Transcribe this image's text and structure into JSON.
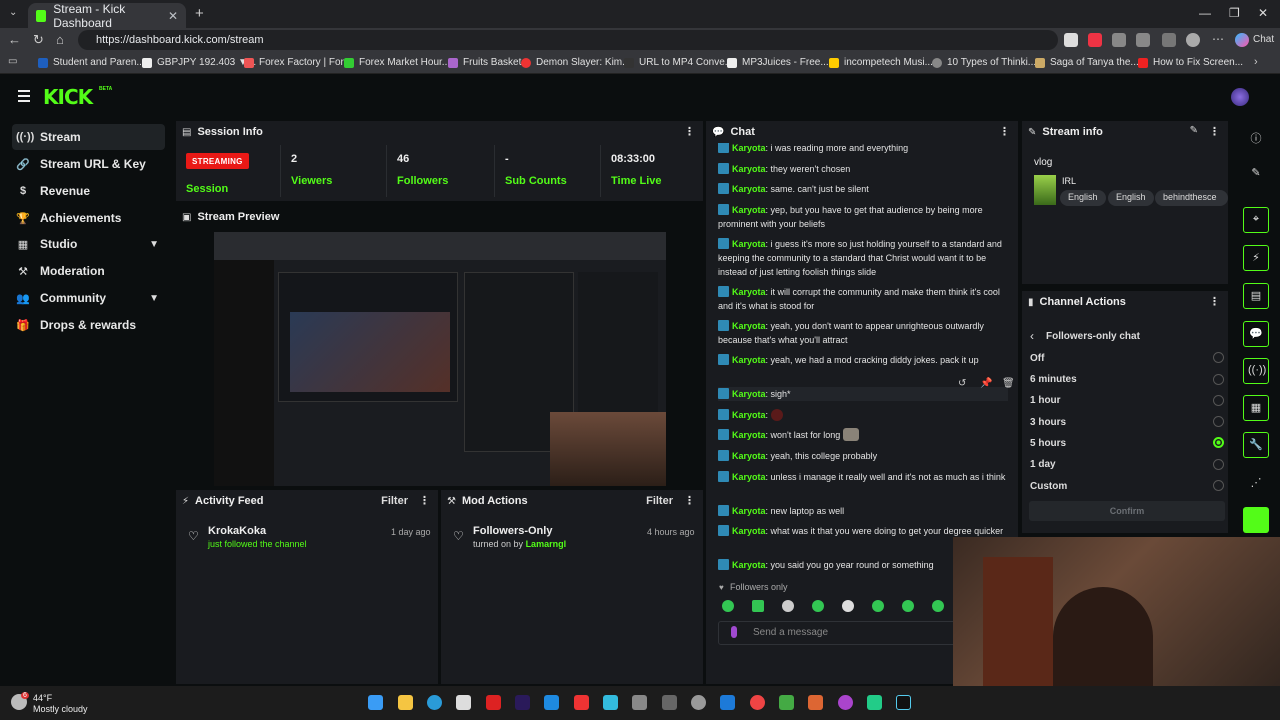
{
  "browser": {
    "tab_title": "Stream - Kick Dashboard",
    "new_tab": "+",
    "url": "https://dashboard.kick.com/stream",
    "chat_label": "Chat",
    "bookmarks": [
      "Student and Paren...",
      "GBPJPY 192.403 ▼...",
      "Forex Factory | For...",
      "Forex Market Hour...",
      "Fruits Basket",
      "Demon Slayer: Kim...",
      "URL to MP4 Conve...",
      "MP3Juices - Free...",
      "incompetech Musi...",
      "10 Types of Thinki...",
      "Saga of Tanya the...",
      "How to Fix Screen..."
    ]
  },
  "app": {
    "logo": "KICK",
    "beta": "BETA"
  },
  "sidebar": {
    "items": [
      {
        "label": "Stream",
        "icon": "broadcast-icon"
      },
      {
        "label": "Stream URL & Key",
        "icon": "link-icon"
      },
      {
        "label": "Revenue",
        "icon": "money-icon"
      },
      {
        "label": "Achievements",
        "icon": "trophy-icon"
      },
      {
        "label": "Studio",
        "icon": "studio-icon"
      },
      {
        "label": "Moderation",
        "icon": "hammer-icon"
      },
      {
        "label": "Community",
        "icon": "users-icon"
      },
      {
        "label": "Drops & rewards",
        "icon": "gift-icon"
      }
    ]
  },
  "session": {
    "title": "Session Info",
    "status": "STREAMING",
    "status_label": "Session",
    "viewers": "2",
    "viewers_label": "Viewers",
    "followers": "46",
    "followers_label": "Followers",
    "subs": "-",
    "subs_label": "Sub Counts",
    "time": "08:33:00",
    "time_label": "Time Live"
  },
  "preview": {
    "title": "Stream Preview"
  },
  "activity": {
    "title": "Activity Feed",
    "filter": "Filter",
    "item_name": "KrokaKoka",
    "item_sub": "just followed the channel",
    "item_time": "1 day ago"
  },
  "mod_actions": {
    "title": "Mod Actions",
    "filter": "Filter",
    "item_name": "Followers-Only",
    "item_sub_prefix": "turned on by",
    "item_sub_user": "Lamarngl",
    "item_time": "4 hours ago"
  },
  "chat": {
    "title": "Chat",
    "user": "Karyota",
    "messages": [
      "i was reading more and everything",
      "they weren't chosen",
      "same. can't just be silent",
      "yep, but you have to get that audience by being more prominent with your beliefs",
      "i guess it's more so just holding yourself to a standard and keeping the community to a standard that Christ would want it to be instead of just letting foolish things slide",
      "it will corrupt the community and make them think it's cool and it's what is stood for",
      "yeah, you don't want to appear unrighteous outwardly because that's what you'll attract",
      "yeah, we had a mod cracking diddy jokes. pack it up",
      "sigh*",
      "",
      "won't last for long",
      "yeah, this college probably",
      "unless i manage it really well and it's not as much as i think",
      "new laptop as well",
      "what was it that you were doing to get your degree quicker",
      "you said you go year round or something"
    ],
    "followers_only": "Followers only",
    "placeholder": "Send a message"
  },
  "stream_info": {
    "title": "Stream info",
    "stream_title": "vlog",
    "category": "IRL",
    "tags": [
      "English",
      "English",
      "behindthesce"
    ]
  },
  "channel_actions": {
    "title": "Channel Actions",
    "back_label": "Followers-only chat",
    "options": [
      "Off",
      "6 minutes",
      "1 hour",
      "3 hours",
      "5 hours",
      "1 day",
      "Custom"
    ],
    "selected": "5 hours",
    "confirm": "Confirm"
  },
  "taskbar": {
    "temp": "44°F",
    "weather": "Mostly cloudy",
    "badge": "6"
  }
}
